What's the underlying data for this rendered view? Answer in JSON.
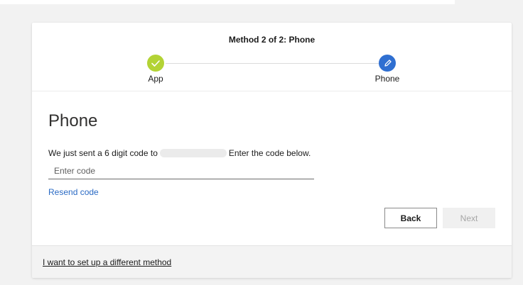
{
  "wizard": {
    "method_title": "Method 2 of 2: Phone",
    "steps": [
      {
        "label": "App",
        "status": "completed",
        "icon": "check-icon",
        "color": "#b3d335"
      },
      {
        "label": "Phone",
        "status": "current",
        "icon": "pencil-icon",
        "color": "#2f6fd1"
      }
    ]
  },
  "main": {
    "title": "Phone",
    "instruction_prefix": "We just sent a 6 digit code to",
    "instruction_suffix": "Enter the code below.",
    "code_input": {
      "value": "",
      "placeholder": "Enter code"
    },
    "resend_label": "Resend code",
    "back_label": "Back",
    "next_label": "Next"
  },
  "footer": {
    "different_method_label": "I want to set up a different method"
  },
  "colors": {
    "link": "#2a6ac4",
    "completed": "#b3d335",
    "current": "#2f6fd1"
  }
}
